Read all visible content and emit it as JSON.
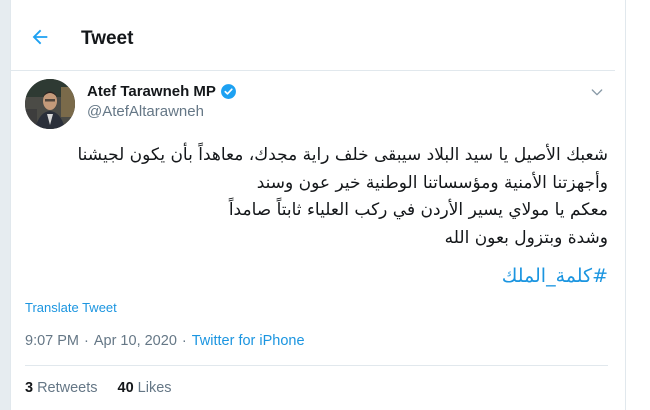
{
  "header": {
    "title": "Tweet",
    "back_icon": "arrow-left-icon"
  },
  "author": {
    "name": "Atef Tarawneh MP",
    "handle": "@AtefAltarawneh",
    "verified_icon": "verified-badge-icon",
    "menu_icon": "chevron-down-icon"
  },
  "tweet": {
    "lines": [
      "شعبك الأصيل يا سيد البلاد سيبقى خلف راية مجدك، معاهداً بأن يكون لجيشنا",
      "وأجهزتنا الأمنية ومؤسساتنا الوطنية خير عون وسند",
      "معكم يا مولاي يسير الأردن في ركب العلياء ثابتاً صامداً",
      "وشدة وبتزول بعون الله"
    ],
    "hashtag": "#كلمة_الملك",
    "translate_label": "Translate Tweet",
    "time": "9:07 PM",
    "date": "Apr 10, 2020",
    "separator": "·",
    "source": "Twitter for iPhone"
  },
  "stats": {
    "retweets_count": "3",
    "retweets_label": "Retweets",
    "likes_count": "40",
    "likes_label": "Likes"
  },
  "colors": {
    "accent": "#1b95e0",
    "text": "#14171a",
    "secondary": "#657786",
    "border": "#e1e8ed",
    "background": "#e6ecf0"
  }
}
